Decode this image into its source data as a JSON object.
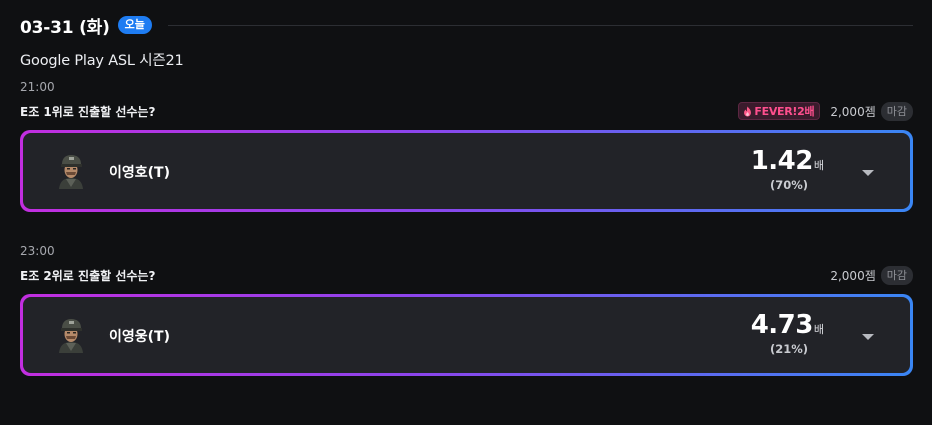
{
  "header": {
    "date": "03-31 (화)",
    "today_badge": "오늘"
  },
  "league": "Google Play ASL 시즌21",
  "matches": [
    {
      "time": "21:00",
      "question": "E조 1위로 진출할 선수는?",
      "fever": {
        "visible": true,
        "label": "FEVER!",
        "multiplier": "2배",
        "icon": "flame-icon",
        "color": "#ff4f8e"
      },
      "points": "2,000젬",
      "status": "마감",
      "option": {
        "player": "이영호(T)",
        "odds": "1.42",
        "odds_unit": "배",
        "percent": "(70%)",
        "avatar_icon": "terran-soldier-avatar"
      }
    },
    {
      "time": "23:00",
      "question": "E조 2위로 진출할 선수는?",
      "fever": {
        "visible": false
      },
      "points": "2,000젬",
      "status": "마감",
      "option": {
        "player": "이영웅(T)",
        "odds": "4.73",
        "odds_unit": "배",
        "percent": "(21%)",
        "avatar_icon": "terran-soldier-avatar"
      }
    }
  ],
  "colors": {
    "background": "#0f1012",
    "card": "#222328",
    "accent_blue": "#1e7cf2",
    "gradient_start": "#c22ee0",
    "gradient_end": "#3a86f4",
    "fever_pink": "#ff4f8e"
  }
}
